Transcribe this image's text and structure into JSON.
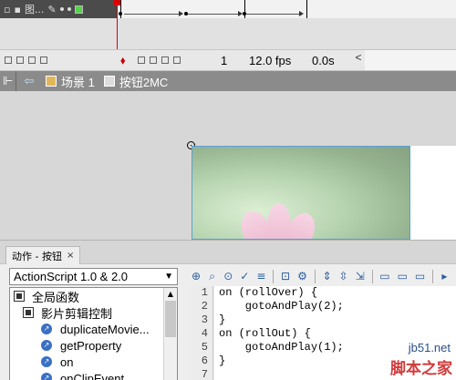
{
  "timeline": {
    "layer_name": "图...",
    "frame_number": "1",
    "fps": "12.0 fps",
    "time": "0.0s"
  },
  "edit_bar": {
    "scene_label": "场景 1",
    "symbol_label": "按钮2MC"
  },
  "actions_panel": {
    "tab_label": "动作 - 按钮",
    "close_label": "×",
    "version_select": "ActionScript 1.0 & 2.0",
    "tree_items": [
      {
        "label": "全局函数",
        "type": "book"
      },
      {
        "label": "影片剪辑控制",
        "type": "book"
      },
      {
        "label": "duplicateMovie...",
        "type": "function"
      },
      {
        "label": "getProperty",
        "type": "function"
      },
      {
        "label": "on",
        "type": "function"
      },
      {
        "label": "onClipEvent",
        "type": "function"
      }
    ],
    "line_numbers": [
      "1",
      "2",
      "3",
      "4",
      "5",
      "6",
      "7"
    ],
    "code_lines": [
      "on (rollOver) {",
      "    gotoAndPlay(2);",
      "}",
      "on (rollOut) {",
      "    gotoAndPlay(1);",
      "}",
      ""
    ]
  },
  "watermark": {
    "url": "jb51.net",
    "name": "脚本之家"
  },
  "icons": {
    "back": "back-arrow-icon",
    "scene": "scene-icon",
    "symbol": "movieclip-symbol-icon"
  }
}
